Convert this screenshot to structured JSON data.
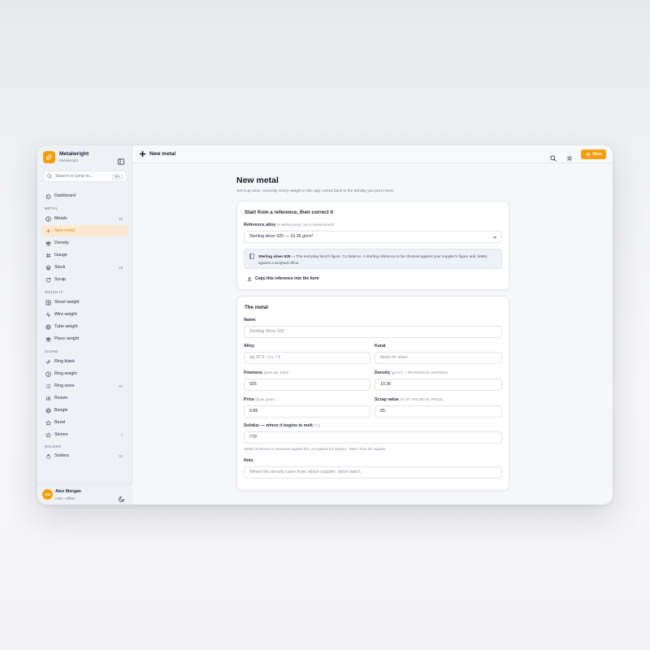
{
  "app": {
    "name": "Metalwright",
    "subtitle": "Metalwright",
    "accent": "#f59e0b"
  },
  "search": {
    "placeholder": "Search or jump to...",
    "shortcut": "⌘K"
  },
  "sidebar": {
    "items": [
      {
        "label": "Dashboard",
        "icon": "home-icon"
      },
      {
        "label": "Metals",
        "icon": "coin-icon",
        "count": "10"
      },
      {
        "label": "New metal",
        "icon": "plus-icon",
        "active": true
      },
      {
        "label": "Density",
        "icon": "scale-icon"
      },
      {
        "label": "Gauge",
        "icon": "hash-icon"
      },
      {
        "label": "Stock",
        "icon": "layers-icon",
        "count": "18"
      },
      {
        "label": "Scrap",
        "icon": "recycle-icon"
      },
      {
        "label": "Sheet weight",
        "icon": "grid-icon"
      },
      {
        "label": "Wire weight",
        "icon": "wave-icon"
      },
      {
        "label": "Tube weight",
        "icon": "circle-icon"
      },
      {
        "label": "Piece weight",
        "icon": "scale-icon"
      },
      {
        "label": "Ring blank",
        "icon": "link-icon"
      },
      {
        "label": "Ring weight",
        "icon": "coin-icon"
      },
      {
        "label": "Ring sizes",
        "icon": "list-icon",
        "count": "97"
      },
      {
        "label": "Resize",
        "icon": "sliders-icon"
      },
      {
        "label": "Bangle",
        "icon": "target-icon"
      },
      {
        "label": "Bezel",
        "icon": "star-icon"
      },
      {
        "label": "Stones",
        "icon": "star-icon",
        "count": "7"
      },
      {
        "label": "Solders",
        "icon": "flame-icon",
        "count": "10"
      }
    ],
    "sections": [
      "METAL",
      "WEIGH IT",
      "SIZING",
      "SOLDER"
    ]
  },
  "user": {
    "initials": "AM",
    "name": "Alex Morgan",
    "status": "USD • offline"
  },
  "topbar": {
    "title": "New metal",
    "new_label": "New"
  },
  "page": {
    "title": "New metal",
    "subtitle": "Set it up once, correctly. Every weight in this app comes back to the density you put in here."
  },
  "reference_card": {
    "heading": "Start from a reference, then correct it",
    "label": "Reference alloy",
    "label_hint": "(a starting point, not a measurement)",
    "selected": "Sterling silver 925 — 10.36 g/cm³",
    "info_name": "Sterling silver 925",
    "info_text": "— The everyday bench figure. Cu balance. A starting reference to be checked against your supplier's figure and, better, against a weighed offcut.",
    "copy_label": "Copy this reference into the form"
  },
  "metal_card": {
    "heading": "The metal",
    "name_label": "Name",
    "name_placeholder": "Sterling Silver 925",
    "alloy_label": "Alloy",
    "alloy_placeholder": "Ag 92.5 / Cu 7.5",
    "karat_label": "Karat",
    "karat_placeholder": "blank for silver",
    "fineness_label": "Fineness",
    "fineness_hint": "(parts per 1000)",
    "fineness_value": "925",
    "density_label": "Density",
    "density_hint": "(g/cm³) — REFERENCE, EDITABLE",
    "density_value": "10.36",
    "price_label": "Price",
    "price_hint": "($ per gram)",
    "price_value": "0.85",
    "scrap_label": "Scrap value",
    "scrap_hint": "(% OF THE METAL PRICE)",
    "scrap_value": "85",
    "solidus_label": "Solidus — where it begins to melt",
    "solidus_hint": "(°C)",
    "solidus_value": "779",
    "solidus_note": "Solder headroom is measured against this, not against the liquidus. Take it from the supplier.",
    "note_label": "Note",
    "note_placeholder": "Where the density came from; which supplier; which batch."
  }
}
